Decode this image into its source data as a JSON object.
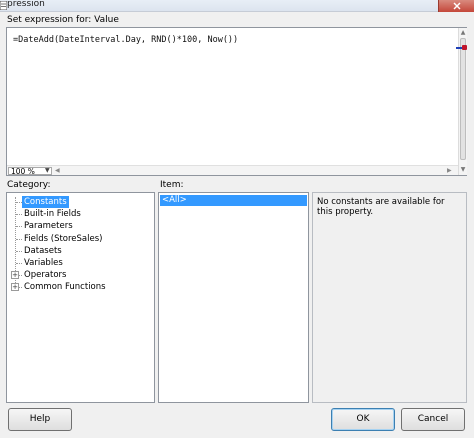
{
  "window": {
    "title": "pression"
  },
  "editor": {
    "label": "Set expression for: Value",
    "expression": "=DateAdd(DateInterval.Day, RND()*100, Now())",
    "zoom": "100 %"
  },
  "category": {
    "label": "Category:",
    "items": [
      {
        "label": "Constants",
        "expandable": false,
        "selected": true
      },
      {
        "label": "Built-in Fields",
        "expandable": false,
        "selected": false
      },
      {
        "label": "Parameters",
        "expandable": false,
        "selected": false
      },
      {
        "label": "Fields (StoreSales)",
        "expandable": false,
        "selected": false
      },
      {
        "label": "Datasets",
        "expandable": false,
        "selected": false
      },
      {
        "label": "Variables",
        "expandable": false,
        "selected": false
      },
      {
        "label": "Operators",
        "expandable": true,
        "selected": false
      },
      {
        "label": "Common Functions",
        "expandable": true,
        "selected": false
      }
    ]
  },
  "item": {
    "label": "Item:",
    "items": [
      "<All>"
    ]
  },
  "description": {
    "text": "No constants are available for this property."
  },
  "buttons": {
    "help": "Help",
    "ok": "OK",
    "cancel": "Cancel"
  },
  "colors": {
    "selection": "#3399ff",
    "close_button": "#c4473a"
  }
}
